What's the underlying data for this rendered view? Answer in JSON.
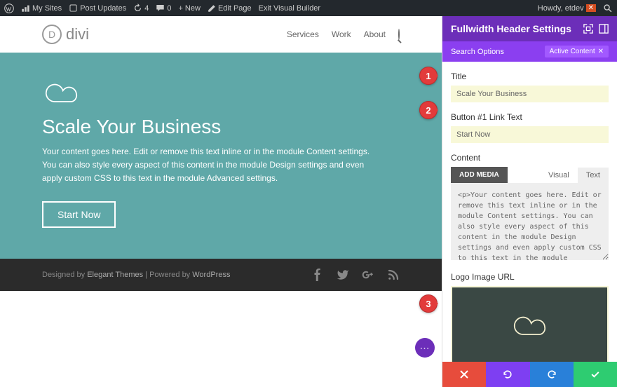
{
  "admin": {
    "mysites": "My Sites",
    "postupdates": "Post Updates",
    "updates_count": "4",
    "comments": "0",
    "new": "New",
    "editpage": "Edit Page",
    "exitvb": "Exit Visual Builder",
    "howdy": "Howdy, etdev"
  },
  "site": {
    "logo_text": "divi",
    "nav": {
      "services": "Services",
      "work": "Work",
      "about": "About"
    }
  },
  "hero": {
    "title": "Scale Your Business",
    "text": "Your content goes here. Edit or remove this text inline or in the module Content settings. You can also style every aspect of this content in the module Design settings and even apply custom CSS to this text in the module Advanced settings.",
    "button": "Start Now"
  },
  "footer": {
    "left_a": "Designed by ",
    "left_b": "Elegant Themes",
    "left_c": " | Powered by ",
    "left_d": "WordPress"
  },
  "panel": {
    "title": "Fullwidth Header Settings",
    "search": "Search Options",
    "active": "Active Content",
    "fields": {
      "title_label": "Title",
      "title_value": "Scale Your Business",
      "btn1_label": "Button #1 Link Text",
      "btn1_value": "Start Now",
      "content_label": "Content",
      "addmedia": "ADD MEDIA",
      "visual": "Visual",
      "text": "Text",
      "content_value": "<p>Your content goes here. Edit or remove this text inline or in the module Content settings. You can also style every aspect of this content in the module Design settings and even apply custom CSS to this text in the module Advanced settings.</p>",
      "logo_label": "Logo Image URL"
    }
  },
  "callouts": {
    "c1": "1",
    "c2": "2",
    "c3": "3"
  }
}
